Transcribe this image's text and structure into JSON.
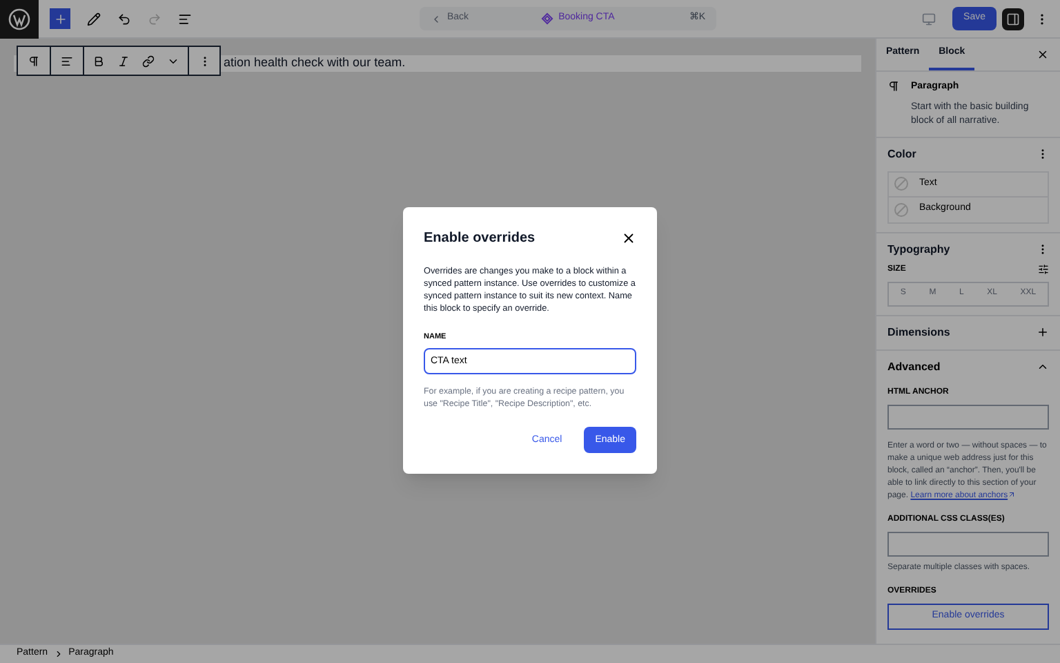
{
  "topbar": {
    "back": "Back",
    "title": "Booking CTA",
    "shortcut": "⌘K",
    "save": "Save"
  },
  "editor": {
    "paragraph": "ation health check with our team."
  },
  "sidebar": {
    "tabs": [
      {
        "label": "Pattern",
        "selected": false
      },
      {
        "label": "Block",
        "selected": true
      }
    ],
    "block": {
      "name": "Paragraph",
      "description": "Start with the basic building block of all narrative."
    },
    "color": {
      "title": "Color",
      "items": [
        "Text",
        "Background"
      ]
    },
    "typography": {
      "title": "Typography",
      "size_label": "SIZE",
      "sizes": [
        {
          "label": "S",
          "selected": false
        },
        {
          "label": "M",
          "selected": false
        },
        {
          "label": "L",
          "selected": false
        },
        {
          "label": "XL",
          "selected": false
        },
        {
          "label": "XXL",
          "selected": false
        }
      ]
    },
    "dimensions": {
      "title": "Dimensions"
    },
    "advanced": {
      "title": "Advanced",
      "expanded": true,
      "anchor_label": "HTML ANCHOR",
      "anchor_help": "Enter a word or two — without spaces — to make a unique web address just for this block, called an “anchor”. Then, you'll be able to link directly to this section of your page.",
      "anchor_link": "Learn more about anchors",
      "css_label": "ADDITIONAL CSS CLASS(ES)",
      "css_help": "Separate multiple classes with spaces.",
      "overrides_label": "OVERRIDES",
      "overrides_button": "Enable overrides"
    }
  },
  "breadcrumb": [
    "Pattern",
    "Paragraph"
  ],
  "dialog": {
    "title": "Enable overrides",
    "body": "Overrides are changes you make to a block within a synced pattern instance. Use overrides to customize a synced pattern instance to suit its new context. Name this block to specify an override.",
    "name_label": "NAME",
    "name_value": "CTA text",
    "help": "For example, if you are creating a recipe pattern, you use \"Recipe Title\", \"Recipe Description\", etc.",
    "cancel": "Cancel",
    "confirm": "Enable"
  }
}
